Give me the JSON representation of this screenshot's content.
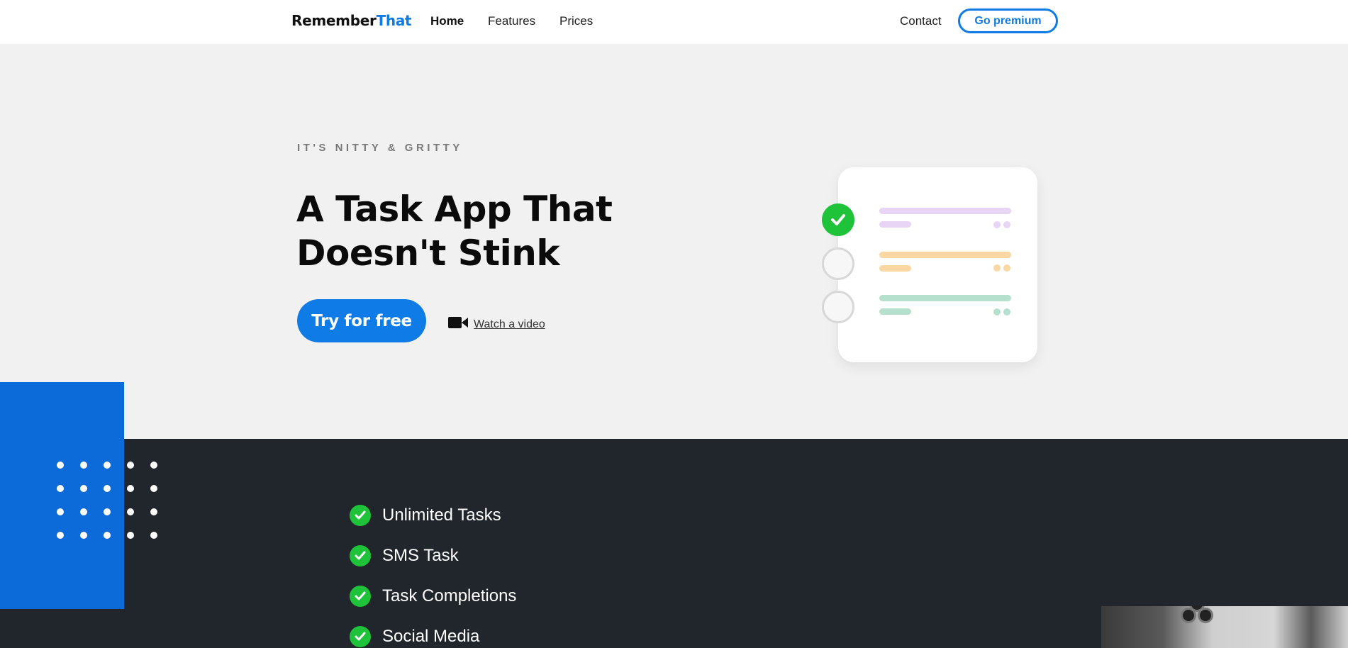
{
  "nav": {
    "logo_main": "Remember",
    "logo_accent": "That",
    "links": [
      "Home",
      "Features",
      "Prices"
    ],
    "contact": "Contact",
    "premium": "Go premium"
  },
  "hero": {
    "eyebrow": "IT'S NITTY & GRITTY",
    "title_line1": "A Task App That",
    "title_line2": "Doesn't Stink",
    "cta": "Try for free",
    "video_link": "Watch a video"
  },
  "illustration": {
    "tasks": [
      {
        "done": true,
        "color": "#e8d4f4"
      },
      {
        "done": false,
        "color": "#fbd7a4"
      },
      {
        "done": false,
        "color": "#b5e0cd"
      }
    ]
  },
  "features": [
    "Unlimited Tasks",
    "SMS Task",
    "Task Completions",
    "Social Media"
  ],
  "colors": {
    "accent": "#0f7be6",
    "check": "#1ec33a",
    "dark_bg": "#21262d",
    "hero_bg": "#f1f1f1",
    "block_blue": "#0d6ad9"
  }
}
